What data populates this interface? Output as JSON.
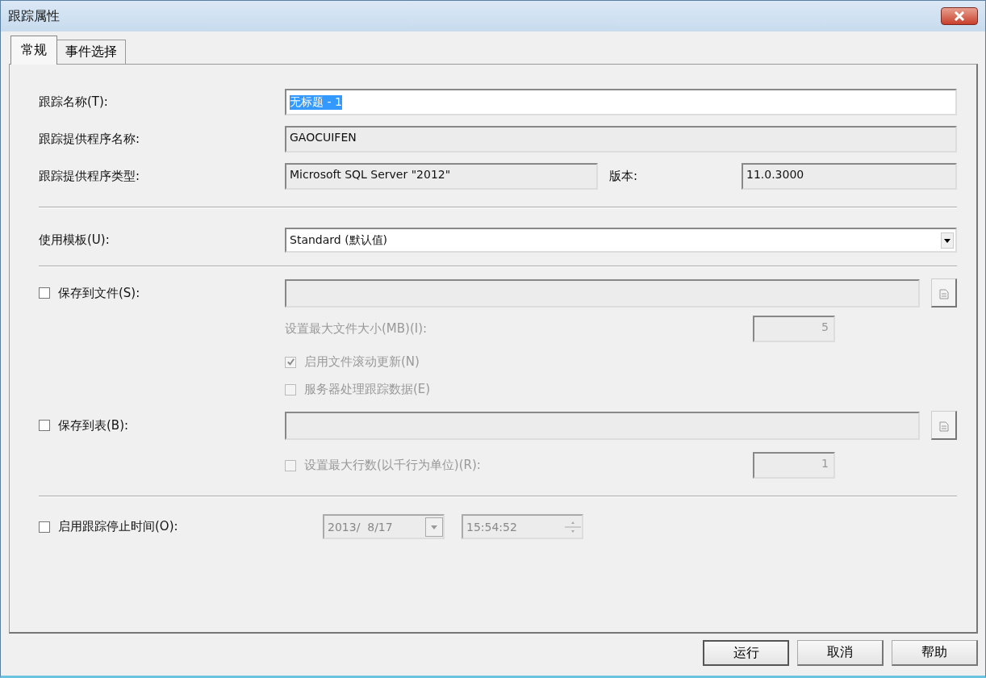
{
  "window": {
    "title": "跟踪属性"
  },
  "tabs": [
    {
      "label": "常规",
      "selected": true
    },
    {
      "label": "事件选择",
      "selected": false
    }
  ],
  "trace_name": {
    "label": "跟踪名称(T):",
    "value": "无标题 - 1",
    "highlighted": true
  },
  "provider_name": {
    "label": "跟踪提供程序名称:",
    "value": "GAOCUIFEN"
  },
  "provider_type": {
    "label": "跟踪提供程序类型:",
    "value": "Microsoft SQL Server \"2012\""
  },
  "version": {
    "label": "版本:",
    "value": "11.0.3000"
  },
  "template": {
    "label": "使用模板(U):",
    "value": "Standard (默认值)"
  },
  "save_to_file": {
    "label": "保存到文件(S):",
    "checked": false,
    "max_size": {
      "label": "设置最大文件大小(MB)(I):",
      "value": "5"
    },
    "options": [
      {
        "label": "启用文件滚动更新(N)",
        "checked": true
      },
      {
        "label": "服务器处理跟踪数据(E)",
        "checked": false
      }
    ]
  },
  "save_to_table": {
    "label": "保存到表(B):",
    "checked": false,
    "max_rows": {
      "label": "设置最大行数(以千行为单位)(R):",
      "checked": false,
      "value": "1"
    }
  },
  "stop_time": {
    "label": "启用跟踪停止时间(O):",
    "checked": false,
    "date": "2013/  8/17",
    "time": "15:54:52"
  },
  "buttons": [
    "运行",
    "取消",
    "帮助"
  ]
}
